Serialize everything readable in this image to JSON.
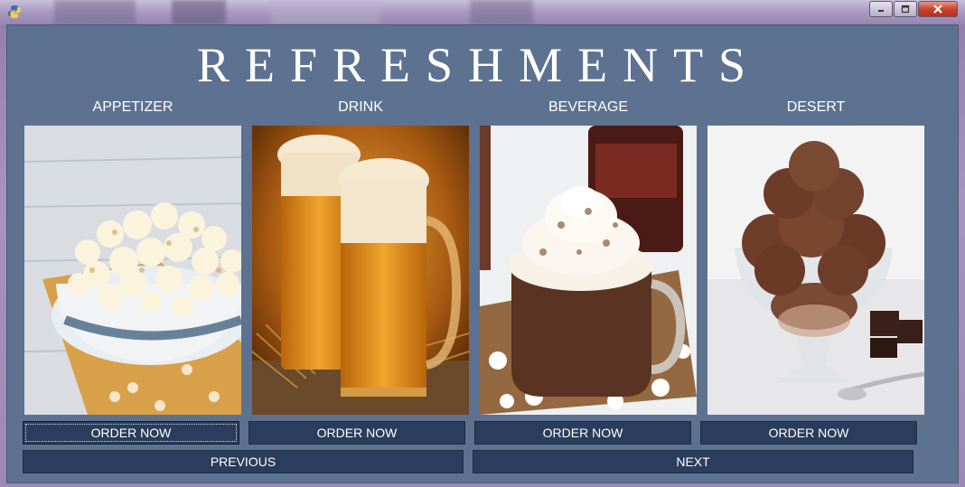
{
  "window": {
    "controls": [
      "minimize",
      "maximize",
      "close"
    ],
    "app_icon": "python-icon"
  },
  "title": "REFRESHMENTS",
  "categories": [
    {
      "label": "APPETIZER",
      "button": "ORDER NOW",
      "image": "popcorn bowl"
    },
    {
      "label": "DRINK",
      "button": "ORDER NOW",
      "image": "beer mugs"
    },
    {
      "label": "BEVERAGE",
      "button": "ORDER NOW",
      "image": "hot cocoa with whipped cream"
    },
    {
      "label": "DESERT",
      "button": "ORDER NOW",
      "image": "chocolate ice cream sundae"
    }
  ],
  "navigation": {
    "previous": "PREVIOUS",
    "next": "NEXT"
  },
  "colors": {
    "panel": "#5d7291",
    "button": "#2b3d5c",
    "text": "#ffffff"
  }
}
